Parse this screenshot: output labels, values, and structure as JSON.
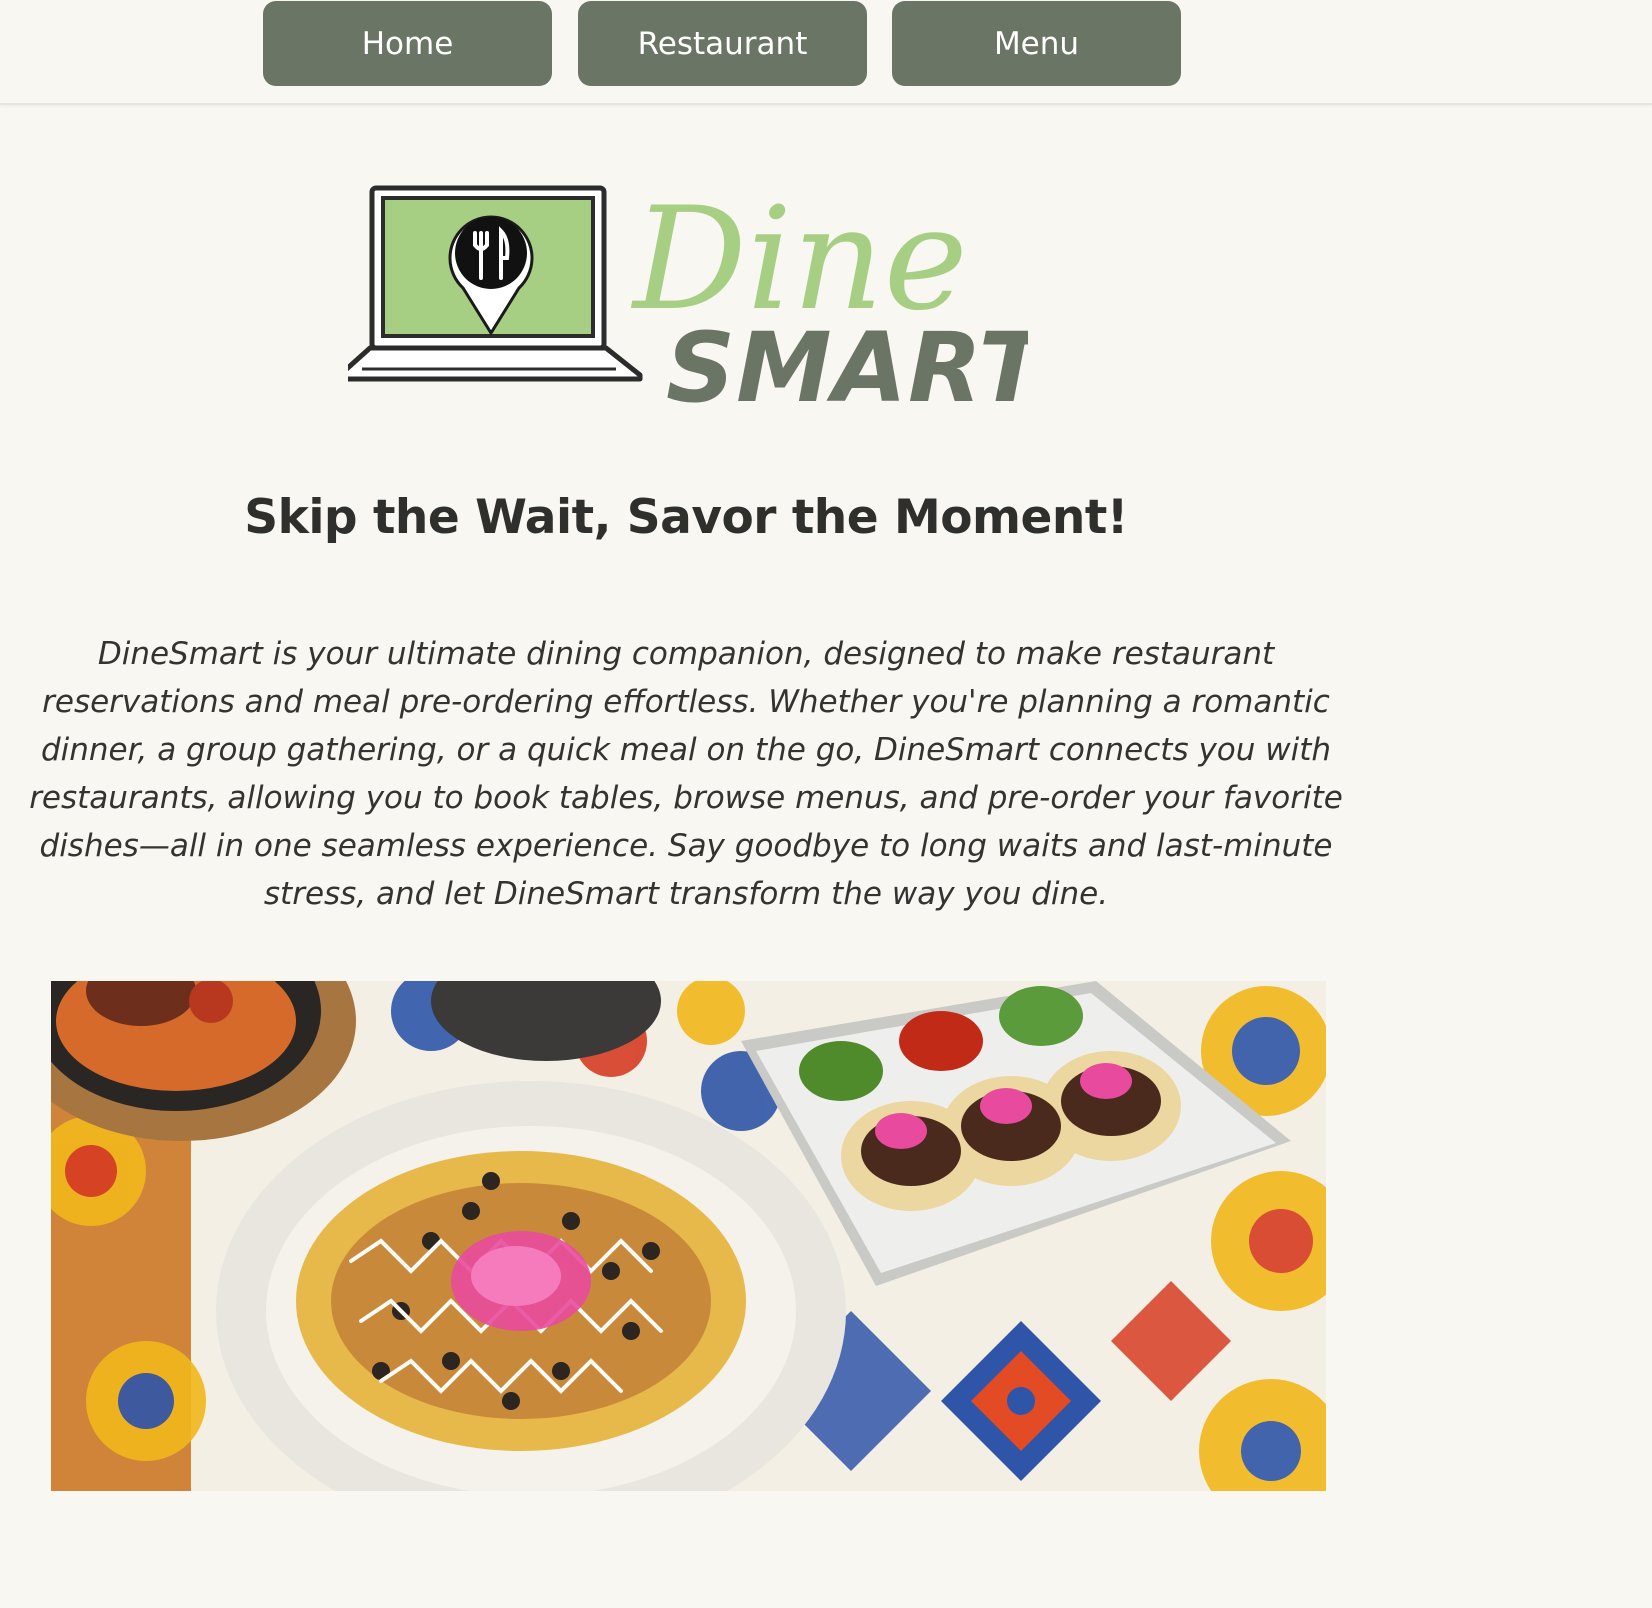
{
  "nav": {
    "items": [
      {
        "label": "Home"
      },
      {
        "label": "Restaurant"
      },
      {
        "label": "Menu"
      }
    ]
  },
  "logo": {
    "word_top": "Dine",
    "word_bottom": "SMART"
  },
  "headline": "Skip the Wait, Savor the Moment!",
  "intro": "DineSmart is your ultimate dining companion, designed to make restaurant reservations and meal pre-ordering effortless. Whether you're planning a romantic dinner, a group gathering, or a quick meal on the go, DineSmart connects you with restaurants, allowing you to book tables, browse menus, and pre-order your favorite dishes—all in one seamless experience. Say goodbye to long waits and last-minute stress, and let DineSmart transform the way you dine.",
  "colors": {
    "nav_button": "#6b7565",
    "logo_green": "#a6cf83",
    "logo_gray": "#6b7565",
    "background": "#f8f7f2"
  }
}
